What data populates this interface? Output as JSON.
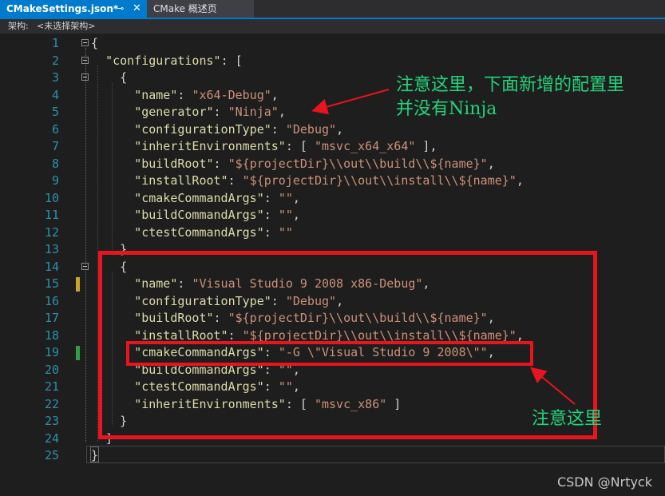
{
  "tabs": [
    {
      "label": "CMakeSettings.json*",
      "active": true
    },
    {
      "label": "CMake 概述页",
      "active": false
    }
  ],
  "tab_icons": {
    "pin": "⊸",
    "close": "✕"
  },
  "toolbar": {
    "arch_label": "架构:",
    "arch_value": "<未选择架构>"
  },
  "lines": [
    {
      "n": "1",
      "fold": true,
      "tokens": [
        [
          "pun",
          "{"
        ]
      ]
    },
    {
      "n": "2",
      "fold": true,
      "tokens": [
        [
          "pun",
          "  "
        ],
        [
          "key",
          "\"configurations\""
        ],
        [
          "pun",
          ": ["
        ]
      ]
    },
    {
      "n": "3",
      "fold": true,
      "tokens": [
        [
          "pun",
          "    {"
        ]
      ]
    },
    {
      "n": "4",
      "tokens": [
        [
          "pun",
          "      "
        ],
        [
          "key",
          "\"name\""
        ],
        [
          "pun",
          ": "
        ],
        [
          "str",
          "\"x64-Debug\""
        ],
        [
          "pun",
          ","
        ]
      ]
    },
    {
      "n": "5",
      "tokens": [
        [
          "pun",
          "      "
        ],
        [
          "key",
          "\"generator\""
        ],
        [
          "pun",
          ": "
        ],
        [
          "str",
          "\"Ninja\""
        ],
        [
          "pun",
          ","
        ]
      ]
    },
    {
      "n": "6",
      "tokens": [
        [
          "pun",
          "      "
        ],
        [
          "key",
          "\"configurationType\""
        ],
        [
          "pun",
          ": "
        ],
        [
          "str",
          "\"Debug\""
        ],
        [
          "pun",
          ","
        ]
      ]
    },
    {
      "n": "7",
      "tokens": [
        [
          "pun",
          "      "
        ],
        [
          "key",
          "\"inheritEnvironments\""
        ],
        [
          "pun",
          ": [ "
        ],
        [
          "str",
          "\"msvc_x64_x64\""
        ],
        [
          "pun",
          " ],"
        ]
      ]
    },
    {
      "n": "8",
      "tokens": [
        [
          "pun",
          "      "
        ],
        [
          "key",
          "\"buildRoot\""
        ],
        [
          "pun",
          ": "
        ],
        [
          "str",
          "\"${projectDir}\\\\out\\\\build\\\\${name}\""
        ],
        [
          "pun",
          ","
        ]
      ]
    },
    {
      "n": "9",
      "tokens": [
        [
          "pun",
          "      "
        ],
        [
          "key",
          "\"installRoot\""
        ],
        [
          "pun",
          ": "
        ],
        [
          "str",
          "\"${projectDir}\\\\out\\\\install\\\\${name}\""
        ],
        [
          "pun",
          ","
        ]
      ]
    },
    {
      "n": "10",
      "tokens": [
        [
          "pun",
          "      "
        ],
        [
          "key",
          "\"cmakeCommandArgs\""
        ],
        [
          "pun",
          ": "
        ],
        [
          "str",
          "\"\""
        ],
        [
          "pun",
          ","
        ]
      ]
    },
    {
      "n": "11",
      "tokens": [
        [
          "pun",
          "      "
        ],
        [
          "key",
          "\"buildCommandArgs\""
        ],
        [
          "pun",
          ": "
        ],
        [
          "str",
          "\"\""
        ],
        [
          "pun",
          ","
        ]
      ]
    },
    {
      "n": "12",
      "tokens": [
        [
          "pun",
          "      "
        ],
        [
          "key",
          "\"ctestCommandArgs\""
        ],
        [
          "pun",
          ": "
        ],
        [
          "str",
          "\"\""
        ]
      ]
    },
    {
      "n": "13",
      "tokens": [
        [
          "pun",
          "    },"
        ]
      ]
    },
    {
      "n": "14",
      "fold": true,
      "tokens": [
        [
          "pun",
          "    {"
        ]
      ]
    },
    {
      "n": "15",
      "mark": "#c8a62a",
      "tokens": [
        [
          "pun",
          "      "
        ],
        [
          "key",
          "\"name\""
        ],
        [
          "pun",
          ": "
        ],
        [
          "str",
          "\"Visual Studio 9 2008 x86-Debug\""
        ],
        [
          "pun",
          ","
        ]
      ]
    },
    {
      "n": "16",
      "tokens": [
        [
          "pun",
          "      "
        ],
        [
          "key",
          "\"configurationType\""
        ],
        [
          "pun",
          ": "
        ],
        [
          "str",
          "\"Debug\""
        ],
        [
          "pun",
          ","
        ]
      ]
    },
    {
      "n": "17",
      "tokens": [
        [
          "pun",
          "      "
        ],
        [
          "key",
          "\"buildRoot\""
        ],
        [
          "pun",
          ": "
        ],
        [
          "str",
          "\"${projectDir}\\\\out\\\\build\\\\${name}\""
        ],
        [
          "pun",
          ","
        ]
      ]
    },
    {
      "n": "18",
      "tokens": [
        [
          "pun",
          "      "
        ],
        [
          "key",
          "\"installRoot\""
        ],
        [
          "pun",
          ": "
        ],
        [
          "str",
          "\"${projectDir}\\\\out\\\\install\\\\${name}\""
        ],
        [
          "pun",
          ","
        ]
      ]
    },
    {
      "n": "19",
      "mark": "#2ea043",
      "tokens": [
        [
          "pun",
          "      "
        ],
        [
          "key",
          "\"cmakeCommandArgs\""
        ],
        [
          "pun",
          ": "
        ],
        [
          "str",
          "\"-G \\\"Visual Studio 9 2008\\\"\""
        ],
        [
          "pun",
          ","
        ]
      ]
    },
    {
      "n": "20",
      "tokens": [
        [
          "pun",
          "      "
        ],
        [
          "key",
          "\"buildCommandArgs\""
        ],
        [
          "pun",
          ": "
        ],
        [
          "str",
          "\"\""
        ],
        [
          "pun",
          ","
        ]
      ]
    },
    {
      "n": "21",
      "tokens": [
        [
          "pun",
          "      "
        ],
        [
          "key",
          "\"ctestCommandArgs\""
        ],
        [
          "pun",
          ": "
        ],
        [
          "str",
          "\"\""
        ],
        [
          "pun",
          ","
        ]
      ]
    },
    {
      "n": "22",
      "tokens": [
        [
          "pun",
          "      "
        ],
        [
          "key",
          "\"inheritEnvironments\""
        ],
        [
          "pun",
          ": [ "
        ],
        [
          "str",
          "\"msvc_x86\""
        ],
        [
          "pun",
          " ]"
        ]
      ]
    },
    {
      "n": "23",
      "tokens": [
        [
          "pun",
          "    }"
        ]
      ]
    },
    {
      "n": "24",
      "tokens": [
        [
          "pun",
          "  ]"
        ]
      ]
    },
    {
      "n": "25",
      "tokens": [
        [
          "pun",
          "}"
        ]
      ]
    }
  ],
  "annotations": {
    "note1": "注意这里，下面新增的配置里\n并没有Ninja",
    "note2": "注意这里"
  },
  "watermark": "CSDN @Nrtyck",
  "colors": {
    "accent": "#007acc",
    "highlight": "#e8141e",
    "annotation": "#22d47a"
  }
}
